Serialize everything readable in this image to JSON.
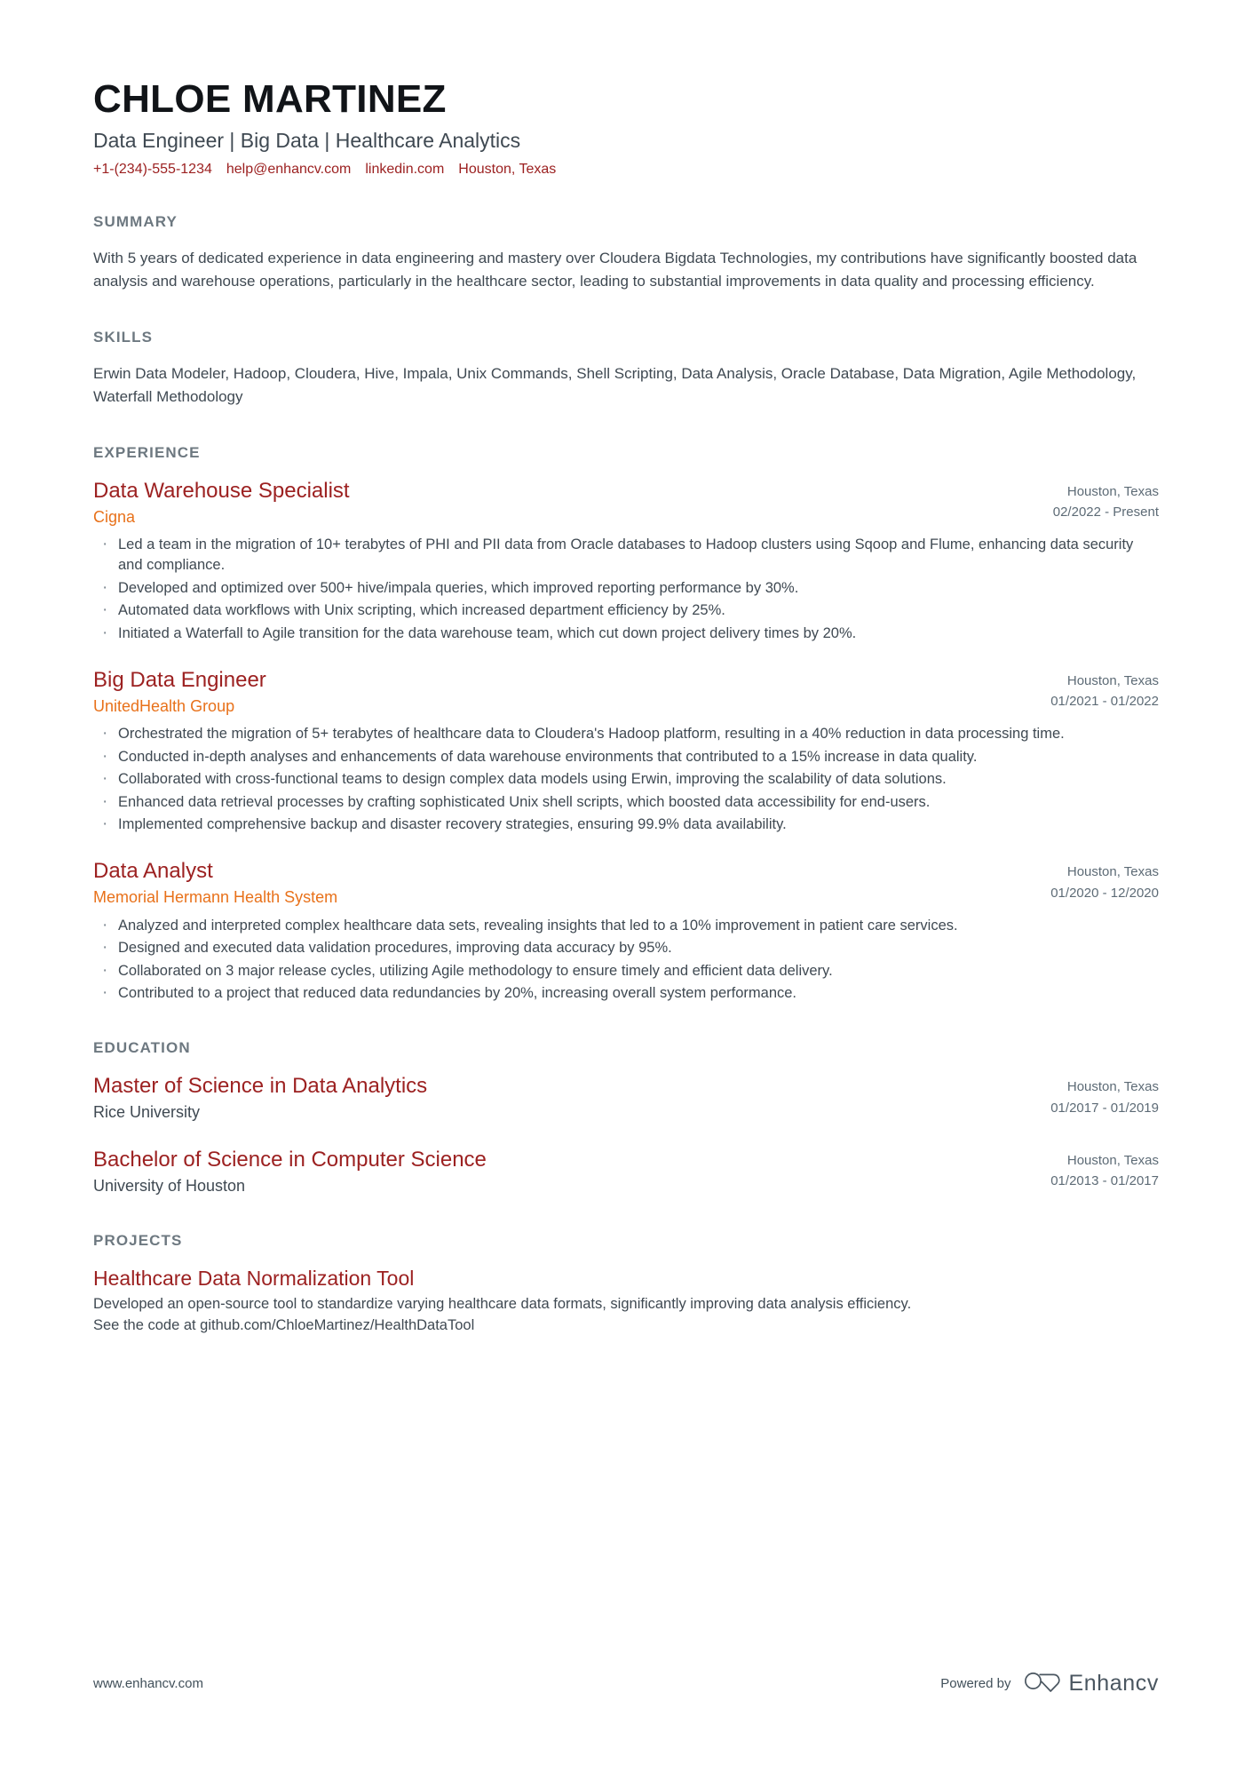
{
  "header": {
    "name": "CHLOE MARTINEZ",
    "headline": "Data Engineer | Big Data | Healthcare Analytics",
    "contacts": [
      {
        "name": "phone",
        "text": "+1-(234)-555-1234"
      },
      {
        "name": "email",
        "text": "help@enhancv.com"
      },
      {
        "name": "linkedin",
        "text": "linkedin.com"
      },
      {
        "name": "location",
        "text": "Houston, Texas"
      }
    ]
  },
  "summary": {
    "title": "SUMMARY",
    "text": "With 5 years of dedicated experience in data engineering and mastery over Cloudera Bigdata Technologies, my contributions have significantly boosted data analysis and warehouse operations, particularly in the healthcare sector, leading to substantial improvements in data quality and processing efficiency."
  },
  "skills": {
    "title": "SKILLS",
    "text": "Erwin Data Modeler, Hadoop, Cloudera, Hive, Impala, Unix Commands, Shell Scripting, Data Analysis, Oracle Database, Data Migration, Agile Methodology, Waterfall Methodology"
  },
  "experience": {
    "title": "EXPERIENCE",
    "entries": [
      {
        "title": "Data Warehouse Specialist",
        "org": "Cigna",
        "location": "Houston, Texas",
        "dates": "02/2022 - Present",
        "bullets": [
          "Led a team in the migration of 10+ terabytes of PHI and PII data from Oracle databases to Hadoop clusters using Sqoop and Flume, enhancing data security and compliance.",
          "Developed and optimized over 500+ hive/impala queries, which improved reporting performance by 30%.",
          "Automated data workflows with Unix scripting, which increased department efficiency by 25%.",
          "Initiated a Waterfall to Agile transition for the data warehouse team, which cut down project delivery times by 20%."
        ]
      },
      {
        "title": "Big Data Engineer",
        "org": "UnitedHealth Group",
        "location": "Houston, Texas",
        "dates": "01/2021 - 01/2022",
        "bullets": [
          "Orchestrated the migration of 5+ terabytes of healthcare data to Cloudera's Hadoop platform, resulting in a 40% reduction in data processing time.",
          "Conducted in-depth analyses and enhancements of data warehouse environments that contributed to a 15% increase in data quality.",
          "Collaborated with cross-functional teams to design complex data models using Erwin, improving the scalability of data solutions.",
          "Enhanced data retrieval processes by crafting sophisticated Unix shell scripts, which boosted data accessibility for end-users.",
          "Implemented comprehensive backup and disaster recovery strategies, ensuring 99.9% data availability."
        ]
      },
      {
        "title": "Data Analyst",
        "org": "Memorial Hermann Health System",
        "location": "Houston, Texas",
        "dates": "01/2020 - 12/2020",
        "bullets": [
          "Analyzed and interpreted complex healthcare data sets, revealing insights that led to a 10% improvement in patient care services.",
          "Designed and executed data validation procedures, improving data accuracy by 95%.",
          "Collaborated on 3 major release cycles, utilizing Agile methodology to ensure timely and efficient data delivery.",
          "Contributed to a project that reduced data redundancies by 20%, increasing overall system performance."
        ]
      }
    ]
  },
  "education": {
    "title": "EDUCATION",
    "entries": [
      {
        "title": "Master of Science in Data Analytics",
        "org": "Rice University",
        "location": "Houston, Texas",
        "dates": "01/2017 - 01/2019"
      },
      {
        "title": "Bachelor of Science in Computer Science",
        "org": "University of Houston",
        "location": "Houston, Texas",
        "dates": "01/2013 - 01/2017"
      }
    ]
  },
  "projects": {
    "title": "PROJECTS",
    "entries": [
      {
        "title": "Healthcare Data Normalization Tool",
        "line1": "Developed an open-source tool to standardize varying healthcare data formats, significantly improving data analysis efficiency.",
        "line2": "See the code at github.com/ChloeMartinez/HealthDataTool"
      }
    ]
  },
  "footer": {
    "url": "www.enhancv.com",
    "powered_by": "Powered by",
    "brand": "Enhancv"
  },
  "colors": {
    "accent_red": "#9c2121",
    "accent_orange": "#e8711a",
    "heading_gray": "#6d7880",
    "body_gray": "#3f4952"
  }
}
